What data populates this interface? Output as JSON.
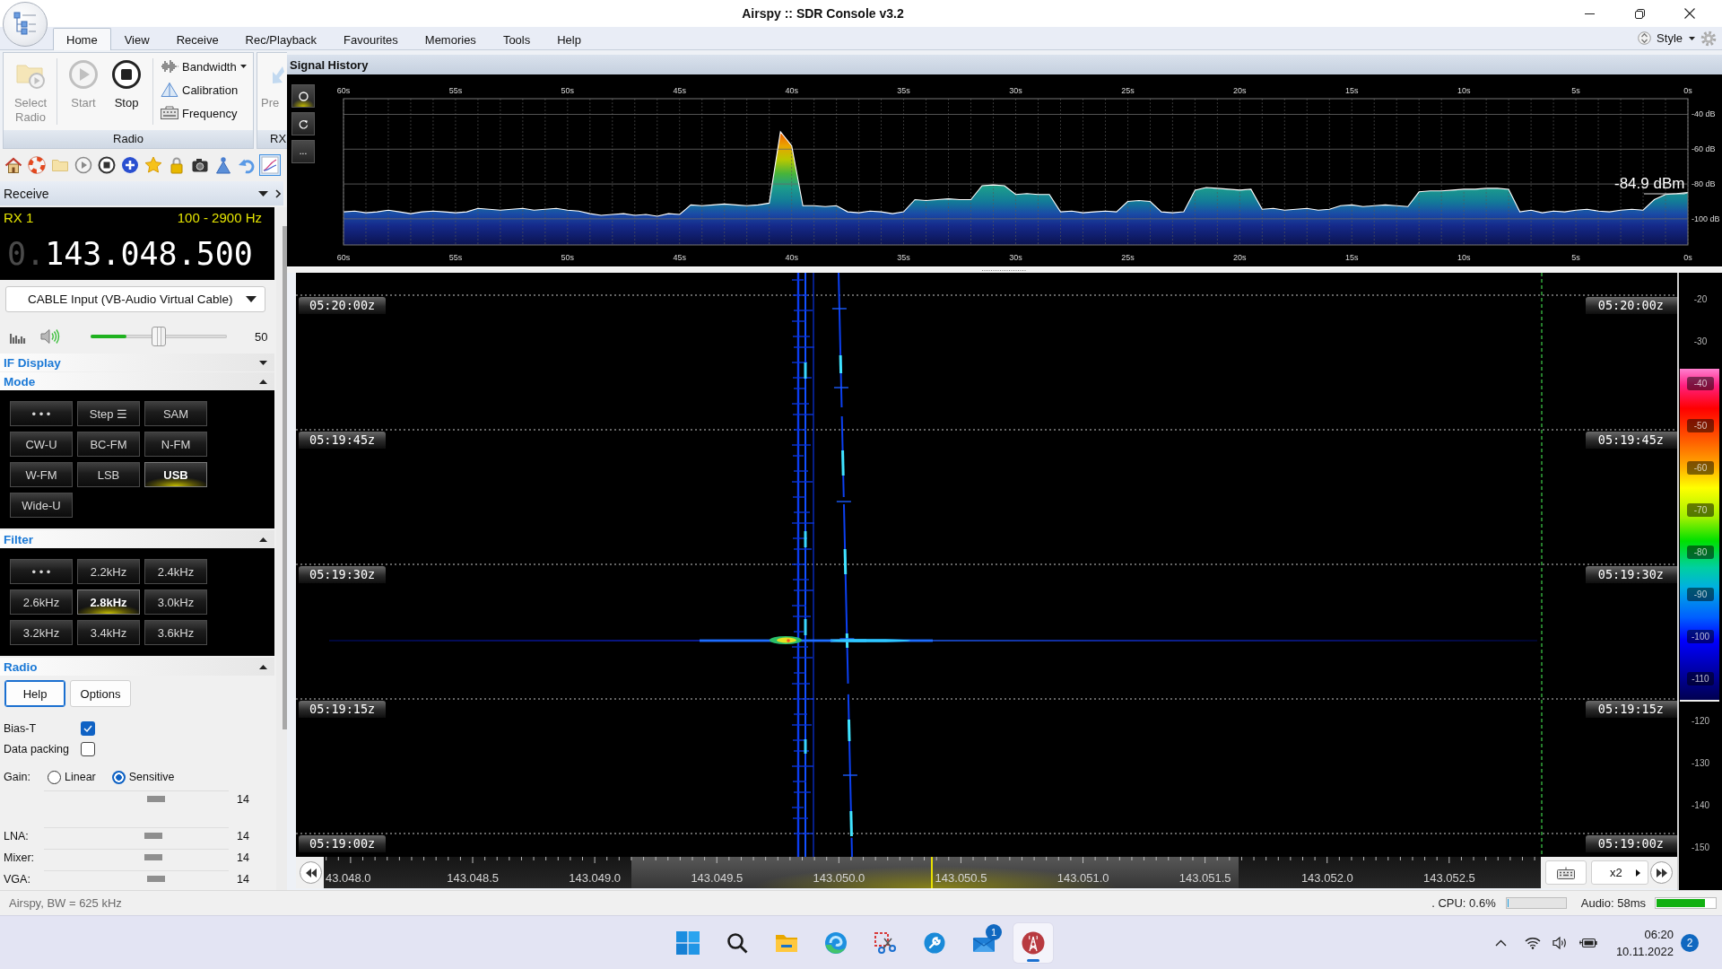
{
  "window": {
    "title": "Airspy :: SDR Console v3.2"
  },
  "ribbon_tabs": [
    {
      "label": "Home",
      "selected": true
    },
    {
      "label": "View",
      "selected": false
    },
    {
      "label": "Receive",
      "selected": false
    },
    {
      "label": "Rec/Playback",
      "selected": false
    },
    {
      "label": "Favourites",
      "selected": false
    },
    {
      "label": "Memories",
      "selected": false
    },
    {
      "label": "Tools",
      "selected": false
    },
    {
      "label": "Help",
      "selected": false
    }
  ],
  "style_menu": {
    "label": "Style"
  },
  "ribbon": {
    "groups": [
      {
        "label": "Radio",
        "large_buttons": [
          {
            "label": "Select Radio",
            "disabled": true
          },
          {
            "label": "Start",
            "disabled": true
          },
          {
            "label": "Stop",
            "disabled": false
          }
        ],
        "small_buttons": [
          {
            "label": "Bandwidth",
            "dropdown": true
          },
          {
            "label": "Calibration",
            "dropdown": false
          },
          {
            "label": "Frequency",
            "dropdown": false
          }
        ]
      },
      {
        "label": "RX",
        "large_buttons": [
          {
            "label": "Pre",
            "disabled": true
          }
        ]
      }
    ]
  },
  "quick_toolbar": [
    {
      "selected": false
    },
    {
      "selected": false
    },
    {
      "selected": false
    },
    {
      "selected": false
    },
    {
      "selected": false
    },
    {
      "selected": false
    },
    {
      "selected": false
    },
    {
      "selected": false
    },
    {
      "selected": false
    },
    {
      "selected": false
    },
    {
      "selected": false
    },
    {
      "selected": true
    }
  ],
  "receive_panel": {
    "title": "Receive"
  },
  "receiver": {
    "rx_label": "RX 1",
    "passband": "100 - 2900 Hz",
    "frequency_prefix": "0.",
    "frequency": "143.048.500"
  },
  "audio_device": {
    "value": "CABLE Input (VB-Audio Virtual Cable)"
  },
  "volume": {
    "level": 0.5,
    "reading": "50"
  },
  "audio_meter": {
    "level": 0.26
  },
  "if_display": {
    "title": "IF Display",
    "expanded": false
  },
  "mode": {
    "title": "Mode",
    "expanded": true,
    "buttons": [
      {
        "label": "• • •",
        "selected": false
      },
      {
        "label": "Step ☰",
        "selected": false
      },
      {
        "label": "SAM",
        "selected": false
      },
      {
        "label": "CW-U",
        "selected": false
      },
      {
        "label": "BC-FM",
        "selected": false
      },
      {
        "label": "N-FM",
        "selected": false
      },
      {
        "label": "W-FM",
        "selected": false
      },
      {
        "label": "LSB",
        "selected": false
      },
      {
        "label": "USB",
        "selected": true
      },
      {
        "label": "Wide-U",
        "selected": false
      }
    ]
  },
  "filter": {
    "title": "Filter",
    "expanded": true,
    "buttons": [
      {
        "label": "• • •",
        "selected": false
      },
      {
        "label": "2.2kHz",
        "selected": false
      },
      {
        "label": "2.4kHz",
        "selected": false
      },
      {
        "label": "2.6kHz",
        "selected": false
      },
      {
        "label": "2.8kHz",
        "selected": true
      },
      {
        "label": "3.0kHz",
        "selected": false
      },
      {
        "label": "3.2kHz",
        "selected": false
      },
      {
        "label": "3.4kHz",
        "selected": false
      },
      {
        "label": "3.6kHz",
        "selected": false
      }
    ]
  },
  "radio": {
    "title": "Radio",
    "expanded": true,
    "buttons": [
      {
        "label": "Help",
        "focused": true
      },
      {
        "label": "Options",
        "focused": false
      }
    ],
    "options": [
      {
        "label": "Bias-T",
        "checked": true
      },
      {
        "label": "Data packing",
        "checked": false
      }
    ],
    "gain": {
      "label": "Gain:",
      "choices": [
        {
          "label": "Linear",
          "selected": false
        },
        {
          "label": "Sensitive",
          "selected": true
        }
      ]
    },
    "sliders": [
      {
        "level": 0.62,
        "reading": "14"
      },
      {
        "label": "LNA:",
        "level": 0.6,
        "reading": "14"
      },
      {
        "label": "Mixer:",
        "level": 0.6,
        "reading": "14"
      },
      {
        "label": "VGA:",
        "level": 0.62,
        "reading": "14"
      }
    ]
  },
  "signal_history": {
    "title": "Signal History",
    "tools": [
      {
        "selected": true
      },
      {
        "selected": false
      },
      {
        "label": "...",
        "selected": false
      }
    ],
    "top_axis_labels": [
      "60s",
      "55s",
      "50s",
      "45s",
      "40s",
      "35s",
      "30s",
      "25s",
      "20s",
      "15s",
      "10s",
      "5s",
      "0s"
    ],
    "readout": "-84.9 dBm",
    "chart_data": {
      "type": "line",
      "x": [
        60,
        59.5,
        59,
        58.5,
        58,
        57.5,
        57,
        56.5,
        56,
        55.5,
        55,
        54.5,
        54,
        53.5,
        53,
        52.5,
        52,
        51.5,
        51,
        50.5,
        50,
        49.5,
        49,
        48.5,
        48,
        47.5,
        47,
        46.5,
        46,
        45.5,
        45,
        44.5,
        44,
        43.5,
        43,
        42.5,
        42,
        41.5,
        41,
        40.5,
        40,
        39.5,
        39,
        38.5,
        38,
        37.5,
        37,
        36.5,
        36,
        35.5,
        35,
        34.5,
        34,
        33.5,
        33,
        32.5,
        32,
        31.5,
        31,
        30.5,
        30,
        29.5,
        29,
        28.5,
        28,
        27.5,
        27,
        26.5,
        26,
        25.5,
        25,
        24.5,
        24,
        23.5,
        23,
        22.5,
        22,
        21.5,
        21,
        20.5,
        20,
        19.5,
        19,
        18.5,
        18,
        17.5,
        17,
        16.5,
        16,
        15.5,
        15,
        14.5,
        14,
        13.5,
        13,
        12.5,
        12,
        11.5,
        11,
        10.5,
        10,
        9.5,
        9,
        8.5,
        8,
        7.5,
        7,
        6.5,
        6,
        5.5,
        5,
        4.5,
        4,
        3.5,
        3,
        2.5,
        2,
        1.5,
        1,
        0.5,
        0
      ],
      "series": [
        {
          "color": "#ffffff",
          "values": [
            -96,
            -95.5,
            -96.5,
            -96,
            -95,
            -96,
            -97,
            -96,
            -95.5,
            -96,
            -96.5,
            -96,
            -94,
            -94.5,
            -95,
            -94.5,
            -94,
            -95,
            -94.5,
            -94,
            -95,
            -95.5,
            -97,
            -98,
            -97.5,
            -97,
            -98,
            -97.5,
            -98.5,
            -97,
            -97.5,
            -92,
            -92.5,
            -92,
            -91.5,
            -92,
            -92.5,
            -92,
            -91,
            -50,
            -58,
            -92.5,
            -92.5,
            -93,
            -92.5,
            -96,
            -96.5,
            -95.5,
            -96,
            -97,
            -96,
            -89,
            -89.5,
            -89,
            -88.5,
            -89,
            -89,
            -81,
            -80.5,
            -81,
            -86,
            -85.5,
            -86,
            -86,
            -96,
            -95.5,
            -96.5,
            -96,
            -95.5,
            -96,
            -90,
            -89.5,
            -90,
            -96,
            -96.5,
            -96,
            -83.5,
            -82,
            -82.5,
            -83,
            -83.5,
            -83,
            -94.5,
            -94,
            -95,
            -94.5,
            -94,
            -95,
            -94.5,
            -92.5,
            -92,
            -93,
            -92.5,
            -92,
            -92.5,
            -93,
            -84.5,
            -84,
            -84,
            -83.5,
            -83,
            -83,
            -82.5,
            -82.5,
            -83,
            -96,
            -95,
            -96.5,
            -95.5,
            -96,
            -95,
            -94.5,
            -95.5,
            -96,
            -95,
            -94.5,
            -95,
            -89,
            -86,
            -85.5,
            -84.9
          ]
        }
      ],
      "xlim": [
        60,
        0
      ],
      "ylim": [
        -115,
        -31
      ],
      "xticks": [
        {
          "value": 60,
          "label": "60s"
        },
        {
          "value": 55,
          "label": "55s"
        },
        {
          "value": 50,
          "label": "50s"
        },
        {
          "value": 45,
          "label": "45s"
        },
        {
          "value": 40,
          "label": "40s"
        },
        {
          "value": 35,
          "label": "35s"
        },
        {
          "value": 30,
          "label": "30s"
        },
        {
          "value": 25,
          "label": "25s"
        },
        {
          "value": 20,
          "label": "20s"
        },
        {
          "value": 15,
          "label": "15s"
        },
        {
          "value": 10,
          "label": "10s"
        },
        {
          "value": 5,
          "label": "5s"
        },
        {
          "value": 0,
          "label": "0s"
        }
      ],
      "yticks": [
        {
          "value": -40,
          "label": "-40 dB"
        },
        {
          "value": -60,
          "label": "-60 dB"
        },
        {
          "value": -80,
          "label": "-80 dB"
        },
        {
          "value": -100,
          "label": "-100 dB"
        }
      ],
      "grid": true
    }
  },
  "waterfall": {
    "time_marks": [
      {
        "left": "05:20:00z",
        "right": "05:20:00z"
      },
      {
        "left": "05:19:45z",
        "right": "05:19:45z"
      },
      {
        "left": "05:19:30z",
        "right": "05:19:30z"
      },
      {
        "left": "05:19:15z",
        "right": "05:19:15z"
      },
      {
        "left": "05:19:00z",
        "right": "05:19:00z"
      }
    ],
    "scale": [
      {
        "label": "-20",
        "kind": "plain"
      },
      {
        "label": "-30",
        "kind": "plain"
      },
      {
        "label": "-40",
        "kind": "chip"
      },
      {
        "label": "-50",
        "kind": "chip"
      },
      {
        "label": "-60",
        "kind": "chip"
      },
      {
        "label": "-70",
        "kind": "chip"
      },
      {
        "label": "-80",
        "kind": "chip"
      },
      {
        "label": "-90",
        "kind": "chip"
      },
      {
        "label": "-100",
        "kind": "chip"
      },
      {
        "label": "-110",
        "kind": "chip"
      },
      {
        "label": "-120",
        "kind": "plain"
      },
      {
        "label": "-130",
        "kind": "plain"
      },
      {
        "label": "-140",
        "kind": "plain"
      },
      {
        "label": "-150",
        "kind": "plain"
      }
    ]
  },
  "frequency_axis": {
    "labels": [
      "43.048.0",
      "143.048.5",
      "143.049.0",
      "143.049.5",
      "143.050.0",
      "143.050.5",
      "143.051.0",
      "143.051.5",
      "143.052.0",
      "143.052.5"
    ],
    "zoom": {
      "label": "x2"
    }
  },
  "status_bar": {
    "text": "Airspy, BW = 625 kHz",
    "cpu": ". CPU: 0.6%",
    "cpu_meter": {
      "level": 0.006
    },
    "audio": "Audio: 58ms",
    "audio_meter": {
      "level": 0.8
    }
  },
  "taskbar": {
    "apps": [
      {
        "selected": false
      },
      {
        "selected": false
      },
      {
        "selected": false
      },
      {
        "selected": false
      },
      {
        "selected": false
      },
      {
        "selected": false
      },
      {
        "selected": false,
        "badge": "1"
      },
      {
        "selected": true
      }
    ],
    "time": "06:20",
    "date": "10.11.2022",
    "notifications": "2"
  }
}
